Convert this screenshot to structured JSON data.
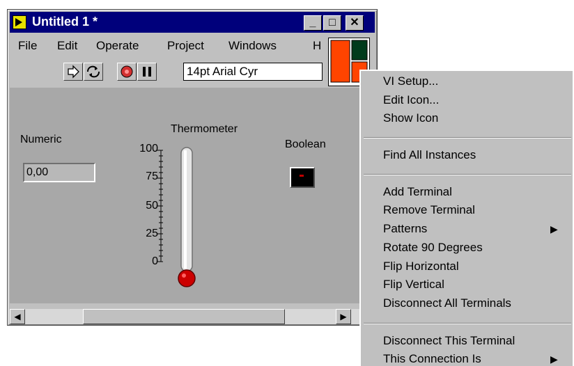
{
  "window": {
    "title": "Untitled 1 *",
    "controls": {
      "minimize": "_",
      "maximize": "□",
      "close": "✕"
    }
  },
  "menubar": {
    "items": [
      {
        "label": "File"
      },
      {
        "label": "Edit"
      },
      {
        "label": "Operate"
      },
      {
        "label": "Project"
      },
      {
        "label": "Windows"
      },
      {
        "label": "H"
      }
    ]
  },
  "toolbar": {
    "font": "14pt Arial Cyr"
  },
  "front_panel": {
    "numeric": {
      "label": "Numeric",
      "value": "0,00"
    },
    "thermometer": {
      "label": "Thermometer",
      "ticks": [
        "100",
        "75",
        "50",
        "25",
        "0"
      ],
      "level": 0
    },
    "boolean": {
      "label": "Boolean"
    }
  },
  "context_menu": {
    "groups": [
      [
        "VI Setup...",
        "Edit Icon...",
        "Show Icon"
      ],
      [
        "Find All Instances"
      ],
      [
        "Add Terminal",
        "Remove Terminal",
        "Patterns",
        "Rotate 90 Degrees",
        "Flip Horizontal",
        "Flip Vertical",
        "Disconnect All Terminals"
      ],
      [
        "Disconnect This Terminal",
        "This Connection Is"
      ]
    ],
    "items": {
      "vi_setup": "VI Setup...",
      "edit_icon": "Edit Icon...",
      "show_icon": "Show Icon",
      "find_all": "Find All Instances",
      "add_terminal": "Add Terminal",
      "remove_terminal": "Remove Terminal",
      "patterns": "Patterns",
      "rotate": "Rotate 90 Degrees",
      "flip_h": "Flip Horizontal",
      "flip_v": "Flip Vertical",
      "disconnect_all": "Disconnect All Terminals",
      "disconnect_this": "Disconnect This Terminal",
      "connection_is": "This Connection Is"
    },
    "submenu_arrow": "▶"
  },
  "colors": {
    "titlebar": "#00007b",
    "panel": "#a8a8a8",
    "chrome": "#c0c0c0",
    "bulb": "#cc0000",
    "icon_orange": "#ff4400",
    "icon_green": "#003b1c"
  }
}
